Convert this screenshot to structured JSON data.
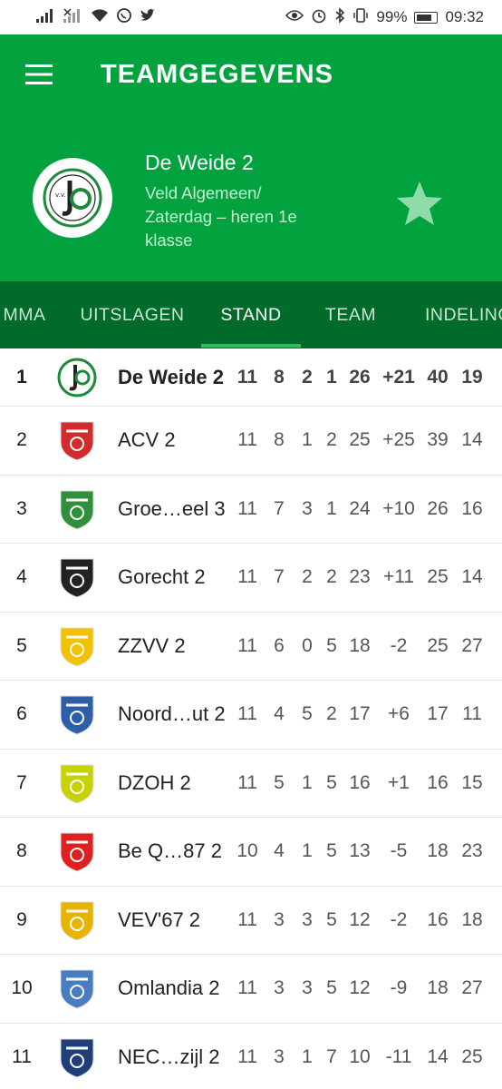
{
  "status_bar": {
    "battery": "99%",
    "time": "09:32"
  },
  "header": {
    "title": "TEAMGEGEVENS",
    "team": {
      "name": "De Weide 2",
      "competition": "Veld Algemeen/ Zaterdag – heren 1e klasse"
    }
  },
  "tabs": [
    {
      "label": "MMA"
    },
    {
      "label": "UITSLAGEN"
    },
    {
      "label": "STAND"
    },
    {
      "label": "TEAM"
    },
    {
      "label": "INDELING"
    }
  ],
  "standings": [
    {
      "pos": "1",
      "team": "De Weide 2",
      "g": "11",
      "w": "8",
      "d": "2",
      "l": "1",
      "pts": "26",
      "diff": "+21",
      "gf": "40",
      "ga": "19",
      "crest_color": "#1b8a3a"
    },
    {
      "pos": "2",
      "team": "ACV 2",
      "g": "11",
      "w": "8",
      "d": "1",
      "l": "2",
      "pts": "25",
      "diff": "+25",
      "gf": "39",
      "ga": "14",
      "crest_color": "#d22b2b"
    },
    {
      "pos": "3",
      "team": "Groe…eel 3",
      "g": "11",
      "w": "7",
      "d": "3",
      "l": "1",
      "pts": "24",
      "diff": "+10",
      "gf": "26",
      "ga": "16",
      "crest_color": "#2f8f3a"
    },
    {
      "pos": "4",
      "team": "Gorecht 2",
      "g": "11",
      "w": "7",
      "d": "2",
      "l": "2",
      "pts": "23",
      "diff": "+11",
      "gf": "25",
      "ga": "14",
      "crest_color": "#222222"
    },
    {
      "pos": "5",
      "team": "ZZVV 2",
      "g": "11",
      "w": "6",
      "d": "0",
      "l": "5",
      "pts": "18",
      "diff": "-2",
      "gf": "25",
      "ga": "27",
      "crest_color": "#f2c200"
    },
    {
      "pos": "6",
      "team": "Noord…ut 2",
      "g": "11",
      "w": "4",
      "d": "5",
      "l": "2",
      "pts": "17",
      "diff": "+6",
      "gf": "17",
      "ga": "11",
      "crest_color": "#2d5fa8"
    },
    {
      "pos": "7",
      "team": "DZOH 2",
      "g": "11",
      "w": "5",
      "d": "1",
      "l": "5",
      "pts": "16",
      "diff": "+1",
      "gf": "16",
      "ga": "15",
      "crest_color": "#c6d300"
    },
    {
      "pos": "8",
      "team": "Be Q…87 2",
      "g": "10",
      "w": "4",
      "d": "1",
      "l": "5",
      "pts": "13",
      "diff": "-5",
      "gf": "18",
      "ga": "23",
      "crest_color": "#e02020"
    },
    {
      "pos": "9",
      "team": "VEV'67 2",
      "g": "11",
      "w": "3",
      "d": "3",
      "l": "5",
      "pts": "12",
      "diff": "-2",
      "gf": "16",
      "ga": "18",
      "crest_color": "#e8b400"
    },
    {
      "pos": "10",
      "team": "Omlandia 2",
      "g": "11",
      "w": "3",
      "d": "3",
      "l": "5",
      "pts": "12",
      "diff": "-9",
      "gf": "18",
      "ga": "27",
      "crest_color": "#4a7cc0"
    },
    {
      "pos": "11",
      "team": "NEC…zijl 2",
      "g": "11",
      "w": "3",
      "d": "1",
      "l": "7",
      "pts": "10",
      "diff": "-11",
      "gf": "14",
      "ga": "25",
      "crest_color": "#1f3f7a"
    }
  ],
  "colors": {
    "primary": "#02a23f",
    "tabs_bg": "#006b2a",
    "tab_indicator": "#2dbf5a",
    "star": "#8fdcaa"
  }
}
